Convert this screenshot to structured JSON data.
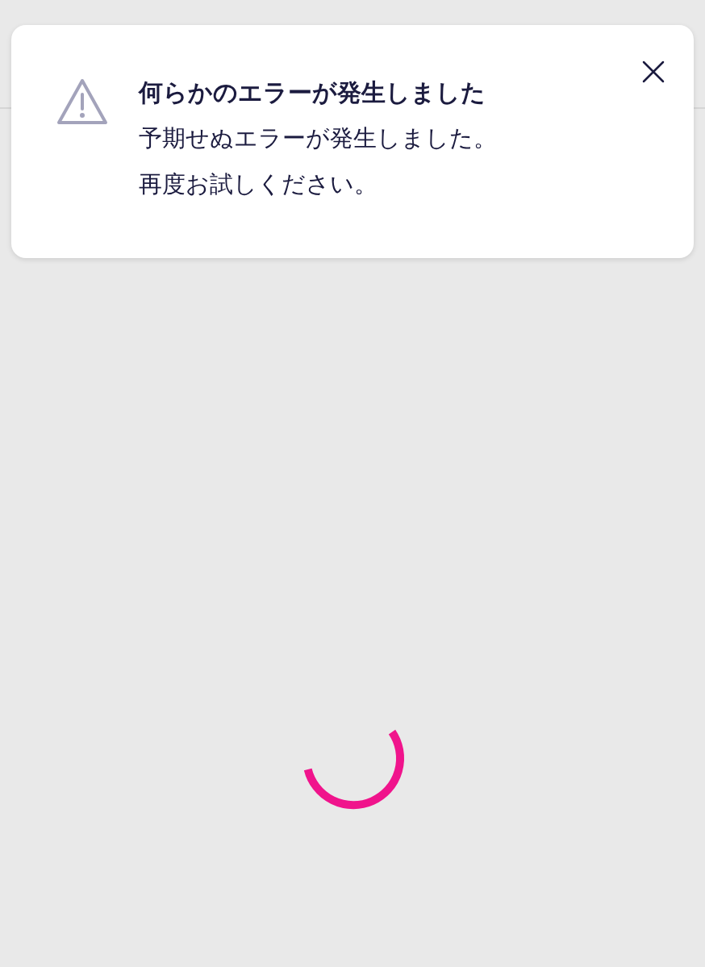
{
  "toast": {
    "title": "何らかのエラーが発生しました",
    "message_lines": [
      "予期せぬエラーが発生しました。",
      "再度お試しください。"
    ]
  },
  "loading": true
}
